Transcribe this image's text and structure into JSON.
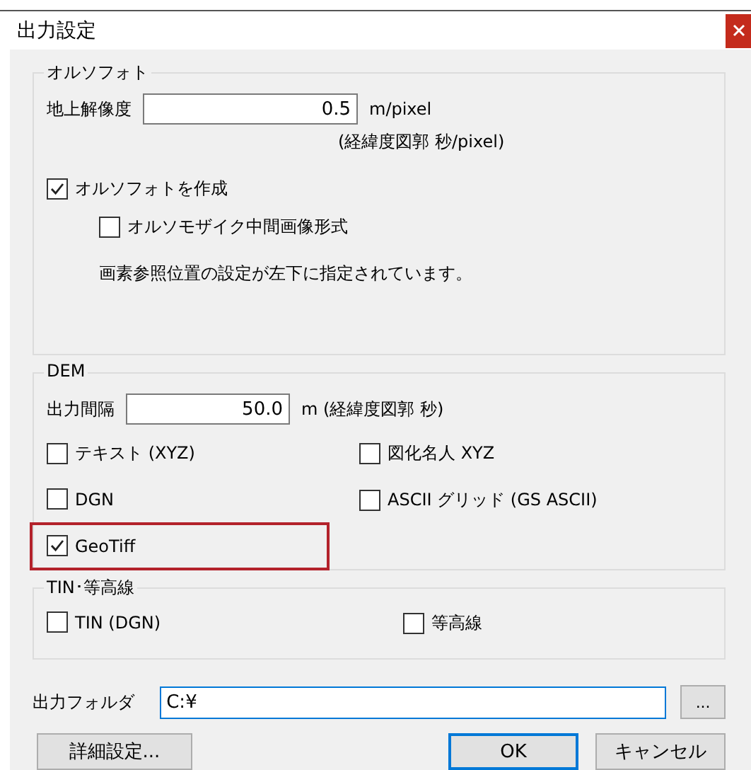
{
  "window": {
    "title": "出力設定"
  },
  "ortho": {
    "legend": "オルソフォト",
    "resolution": {
      "label": "地上解像度",
      "value": "0.5",
      "unit": "m/pixel",
      "note": "(経緯度図郭 秒/pixel)"
    },
    "create": {
      "label": "オルソフォトを作成",
      "checked": true
    },
    "mosaic": {
      "label": "オルソモザイク中間画像形式",
      "checked": false
    },
    "notice": "画素参照位置の設定が左下に指定されています。"
  },
  "dem": {
    "legend": "DEM",
    "interval": {
      "label": "出力間隔",
      "value": "50.0",
      "unit": "m (経緯度図郭 秒)"
    },
    "formats": [
      {
        "label": "テキスト (XYZ)",
        "checked": false,
        "highlighted": false
      },
      {
        "label": "図化名人 XYZ",
        "checked": false,
        "highlighted": false
      },
      {
        "label": "DGN",
        "checked": false,
        "highlighted": false
      },
      {
        "label": "ASCII グリッド (GS ASCII)",
        "checked": false,
        "highlighted": false
      },
      {
        "label": "GeoTiff",
        "checked": true,
        "highlighted": true
      }
    ]
  },
  "tin": {
    "legend": "TIN･等高線",
    "options": [
      {
        "label": "TIN (DGN)",
        "checked": false
      },
      {
        "label": "等高線",
        "checked": false
      }
    ]
  },
  "output_folder": {
    "label": "出力フォルダ",
    "value": "C:¥",
    "browse": "..."
  },
  "buttons": [
    {
      "label": "詳細設定...",
      "default": false
    },
    {
      "label": "OK",
      "default": true
    },
    {
      "label": "キャンセル",
      "default": false
    }
  ]
}
